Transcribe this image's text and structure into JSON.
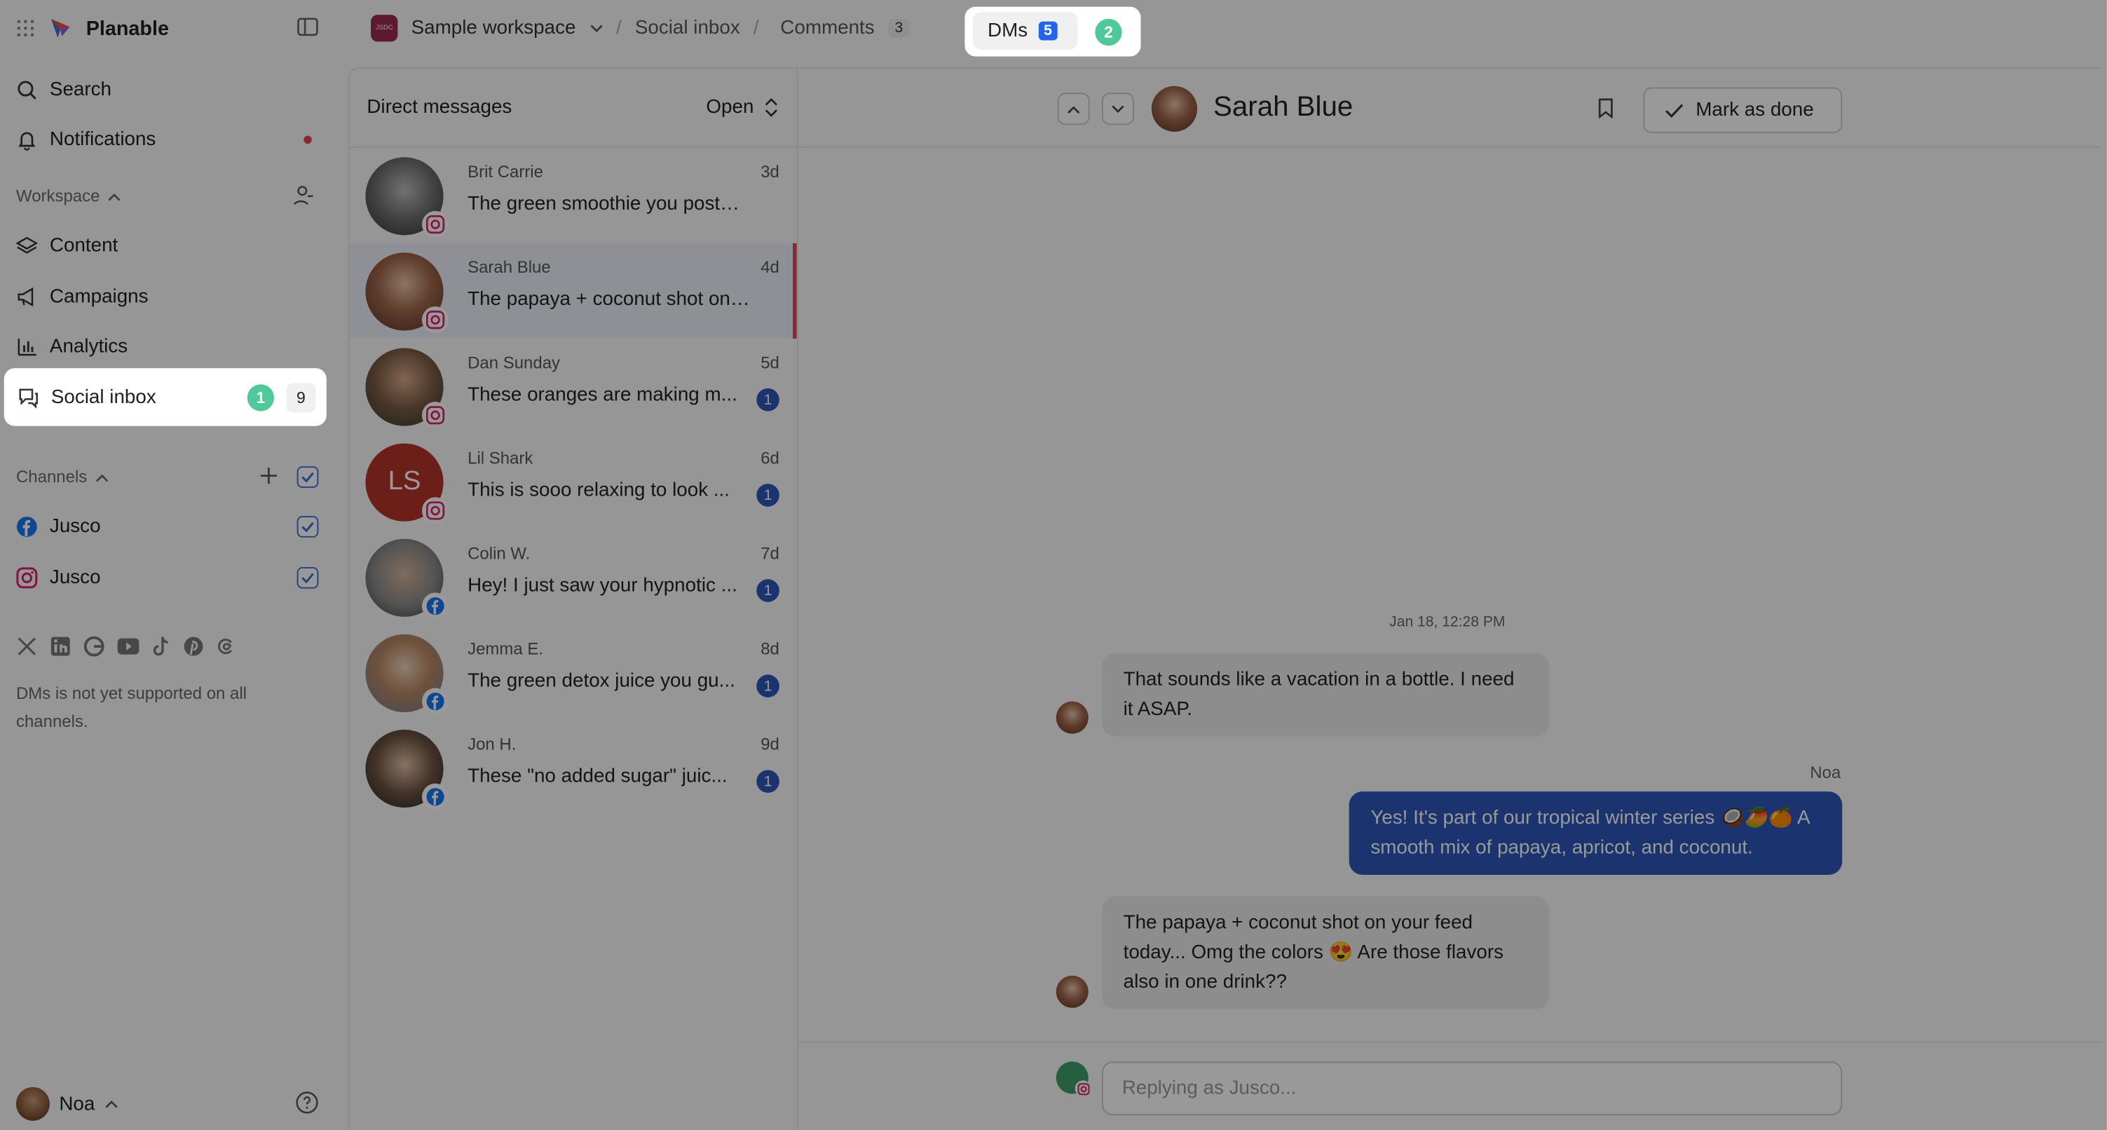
{
  "app": {
    "brand": "Planable"
  },
  "sidebar": {
    "search": "Search",
    "notifications": "Notifications",
    "workspace_header": "Workspace",
    "items": [
      {
        "label": "Content",
        "icon": "layers-icon"
      },
      {
        "label": "Campaigns",
        "icon": "megaphone-icon"
      },
      {
        "label": "Analytics",
        "icon": "bar-chart-icon"
      }
    ],
    "social_inbox": {
      "label": "Social inbox",
      "step": "1",
      "count": "9"
    },
    "channels_header": "Channels",
    "channels": [
      {
        "label": "Jusco",
        "network": "facebook"
      },
      {
        "label": "Jusco",
        "network": "instagram"
      }
    ],
    "unsupported_note": "DMs is not yet supported on all channels.",
    "user": {
      "name": "Noa"
    }
  },
  "breadcrumb": {
    "workspace": "Sample workspace",
    "workspace_logo": "JSDC",
    "section": "Social inbox",
    "comments_label": "Comments",
    "comments_count": "3",
    "dms_label": "DMs",
    "dms_count": "5",
    "step": "2"
  },
  "dm_list": {
    "title": "Direct messages",
    "filter": "Open",
    "threads": [
      {
        "name": "Brit Carrie",
        "time": "3d",
        "preview": "The green smoothie you posted l...",
        "unread": "",
        "network": "instagram",
        "initials": ""
      },
      {
        "name": "Sarah Blue",
        "time": "4d",
        "preview": "The papaya + coconut shot on y...",
        "unread": "",
        "network": "instagram",
        "initials": ""
      },
      {
        "name": "Dan Sunday",
        "time": "5d",
        "preview": "These oranges are making m...",
        "unread": "1",
        "network": "instagram",
        "initials": ""
      },
      {
        "name": "Lil Shark",
        "time": "6d",
        "preview": "This is sooo relaxing to look ...",
        "unread": "1",
        "network": "instagram",
        "initials": "LS"
      },
      {
        "name": "Colin W.",
        "time": "7d",
        "preview": "Hey! I just saw your hypnotic ...",
        "unread": "1",
        "network": "facebook",
        "initials": ""
      },
      {
        "name": "Jemma E.",
        "time": "8d",
        "preview": "The green detox juice you gu...",
        "unread": "1",
        "network": "facebook",
        "initials": ""
      },
      {
        "name": "Jon H.",
        "time": "9d",
        "preview": "These \"no added sugar\" juic...",
        "unread": "1",
        "network": "facebook",
        "initials": ""
      }
    ]
  },
  "conversation": {
    "contact": "Sarah Blue",
    "mark_done": "Mark as done",
    "date": "Jan 18, 12:28 PM",
    "messages": [
      {
        "from": "contact",
        "text": "That sounds like a vacation in a bottle. I need it ASAP."
      },
      {
        "from": "me",
        "sender": "Noa",
        "text": "Yes! It's part of our tropical winter series 🥥🥭🍊 A smooth mix of papaya, apricot, and coconut."
      },
      {
        "from": "contact",
        "text": "The papaya + coconut shot on your feed today... Omg the colors 😍 Are those flavors also in one drink??"
      }
    ],
    "reply_placeholder": "Replying as Jusco..."
  },
  "colors": {
    "accent": "#2d55b8",
    "step_badge": "#4fc99a",
    "alert": "#e5484d"
  }
}
